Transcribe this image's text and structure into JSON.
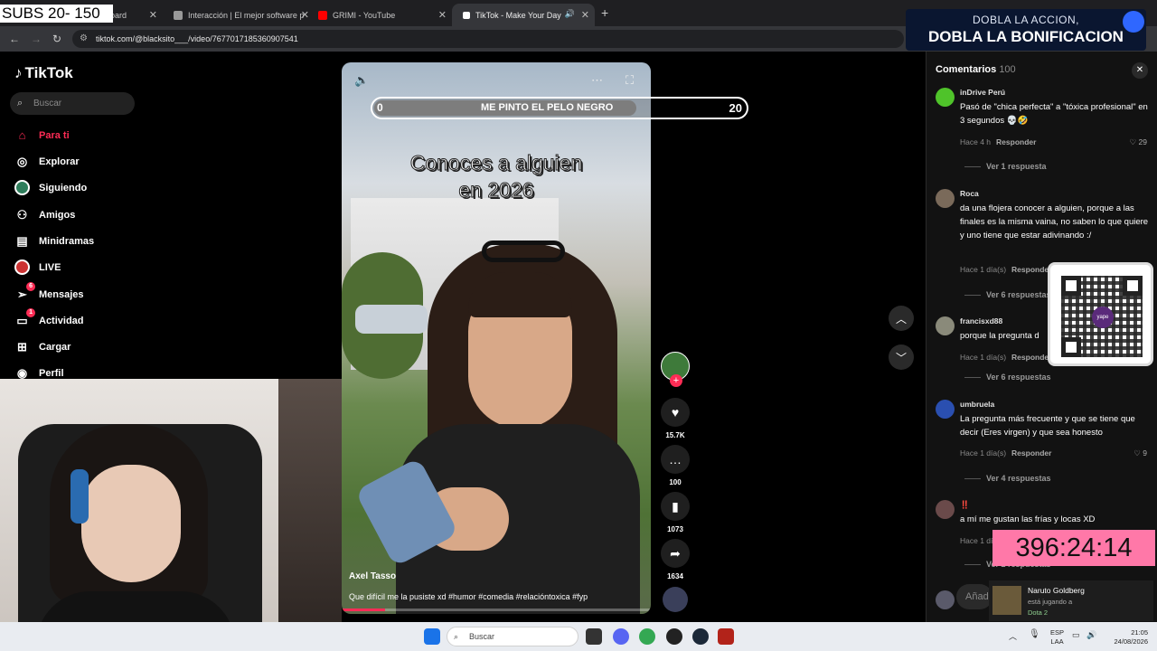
{
  "browser": {
    "tabs": [
      {
        "label": "oard",
        "color": "#888888"
      },
      {
        "label": "Interacción | El mejor software p",
        "color": "#999999"
      },
      {
        "label": "GRIMI - YouTube",
        "color": "#ff0000"
      },
      {
        "label": "TikTok - Make Your Day",
        "color": "#ffffff"
      }
    ],
    "url": "tiktok.com/@blacksito___/video/7677017185360907541"
  },
  "overlay": {
    "subs": "SUBS 20- 150",
    "promo_line1": "DOBLA LA ACCION,",
    "promo_line2": "DOBLA LA BONIFICACION",
    "timer": "396:24:14"
  },
  "sidebar": {
    "logo": "TikTok",
    "search_placeholder": "Buscar",
    "items": [
      {
        "label": "Para ti",
        "icon": "home-icon"
      },
      {
        "label": "Explorar",
        "icon": "compass-icon"
      },
      {
        "label": "Siguiendo",
        "icon": "following-icon"
      },
      {
        "label": "Amigos",
        "icon": "friends-icon"
      },
      {
        "label": "Minidramas",
        "icon": "film-icon"
      },
      {
        "label": "LIVE",
        "icon": "live-icon"
      },
      {
        "label": "Mensajes",
        "icon": "send-icon",
        "badge": "6"
      },
      {
        "label": "Actividad",
        "icon": "inbox-icon",
        "badge": "1"
      },
      {
        "label": "Cargar",
        "icon": "upload-icon"
      },
      {
        "label": "Perfil",
        "icon": "profile-icon"
      }
    ]
  },
  "goal": {
    "low": "0",
    "title": "ME PINTO EL PELO NEGRO",
    "high": "20"
  },
  "video": {
    "caption_line1": "Conoces a alguien",
    "caption_line2": "en 2026",
    "author": "Axel Tasso",
    "description": "Que difícil me la pusiste xd #humor #comedia #relacióntoxica #fyp",
    "progress": 0.14
  },
  "actions": {
    "likes": "15.7K",
    "comments": "100",
    "saves": "1073",
    "shares": "1634"
  },
  "comments": {
    "title": "Comentarios",
    "count": "100",
    "reply_label": "Responder",
    "items": [
      {
        "user": "inDrive Perú",
        "text": "Pasó de \"chica perfecta\" a \"tóxica profesional\" en 3 segundos 💀🤣",
        "time": "Hace 4 h",
        "likes": "29",
        "replies": "Ver 1 respuesta"
      },
      {
        "user": "Roca",
        "text": "da una flojera conocer a alguien, porque a las finales es la misma vaina, no saben lo que quiere y uno tiene que estar adivinando :/",
        "time": "Hace 1 día(s)",
        "replies": "Ver 6 respuestas"
      },
      {
        "user": "francisxd88",
        "text": "porque la pregunta d",
        "time": "Hace 1 día(s)",
        "replies": "Ver 6 respuestas"
      },
      {
        "user": "umbruela",
        "text": "La pregunta más frecuente y que se tiene que decir (Eres virgen) y que sea honesto",
        "time": "Hace 1 día(s)",
        "likes": "9",
        "replies": "Ver 4 respuestas"
      },
      {
        "user": "‼️",
        "text": "a mí me gustan las frías y locas XD",
        "time": "Hace 1 día(s)",
        "replies": "Ver 2 respuestas"
      }
    ],
    "add_placeholder": "Añad"
  },
  "notification": {
    "name": "Naruto Goldberg",
    "status": "está jugando a",
    "game": "Dota 2"
  },
  "taskbar": {
    "search": "Buscar",
    "lang1": "ESP",
    "lang2": "LAA",
    "time": "21:05",
    "date": "24/08/2026"
  },
  "colors": {
    "accent": "#fe2c55",
    "timer_bg": "#ff78a8"
  }
}
